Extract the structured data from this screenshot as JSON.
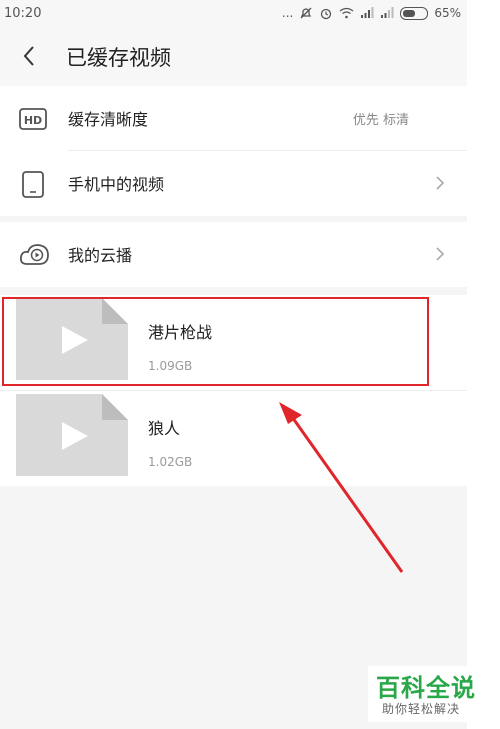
{
  "status_bar": {
    "time": "10:20",
    "indicators": "... ",
    "battery": "65%"
  },
  "header": {
    "title": "已缓存视频"
  },
  "settings": {
    "cache_quality": {
      "label": "缓存清晰度",
      "value": "优先 标清",
      "icon": "hd-icon"
    },
    "phone_videos": {
      "label": "手机中的视频",
      "icon": "phone-icon"
    },
    "my_cloud": {
      "label": "我的云播",
      "icon": "cloud-play-icon"
    }
  },
  "videos": [
    {
      "title": "港片枪战",
      "size": "1.09GB"
    },
    {
      "title": "狼人",
      "size": "1.02GB"
    }
  ],
  "watermark": {
    "title": "百科全说",
    "subtitle": "助你轻松解决"
  },
  "colors": {
    "highlight": "#e0252b",
    "watermark_green": "#2aa748",
    "thumbnail": "#d9d9d9"
  }
}
